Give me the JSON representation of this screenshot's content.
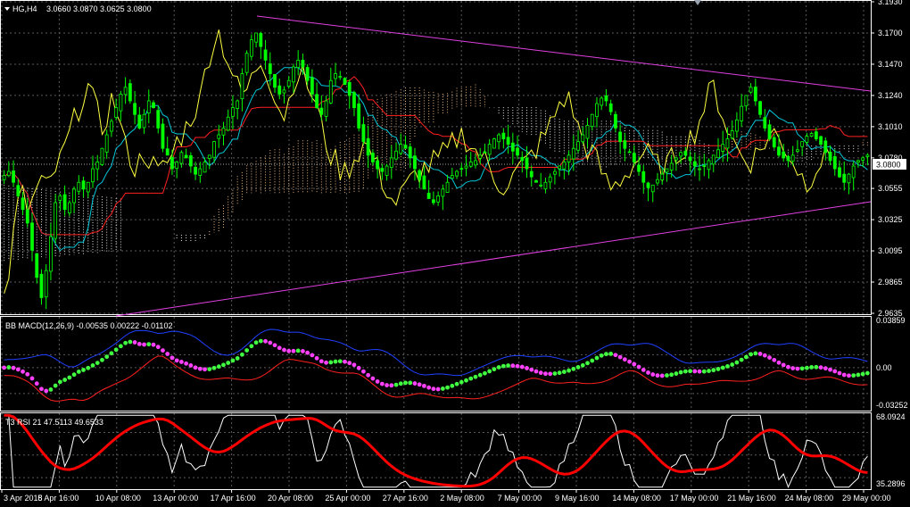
{
  "chart_title": "HG,H4",
  "ohlc": "3.0660 3.0870 3.0625 3.0800",
  "price_tag": "3.0800",
  "macd_title": "BB MACD(12,26,9) -0.00535 0.00222 -0.01102",
  "rsi_title": "T3 RSI 21 47.5113 49.6533",
  "colors": {
    "background": "#000000",
    "grid": "#5a5a5a",
    "bull": "#00ff00",
    "bear": "#00ff00",
    "tenkan": "#00c8d8",
    "kijun": "#ff2020",
    "chikou": "#ffff40",
    "kumo": "#ffc88c",
    "kumo2": "#ffffff",
    "trendline": "#e040e0",
    "macd_up": "#40ff40",
    "macd_down": "#ff40ff",
    "macd_upper": "#2040ff",
    "macd_lower": "#ff2020",
    "rsi_t3": "#ff0000",
    "rsi": "#ffffff"
  },
  "chart_data": [
    {
      "type": "candlestick",
      "title": "HG,H4",
      "ylim": [
        2.9635,
        3.193
      ],
      "y_ticks": [
        "3.1930",
        "3.1700",
        "3.1470",
        "3.1240",
        "3.1010",
        "3.0780",
        "3.0555",
        "3.0325",
        "3.0095",
        "2.9865",
        "2.9635"
      ],
      "last_price": 3.08,
      "x_labels": [
        "3 Apr 2018",
        "5 Apr 16:00",
        "10 Apr 08:00",
        "13 Apr 00:00",
        "17 Apr 16:00",
        "20 Apr 08:00",
        "25 Apr 00:00",
        "27 Apr 16:00",
        "2 May 08:00",
        "7 May 00:00",
        "9 May 16:00",
        "14 May 08:00",
        "17 May 00:00",
        "21 May 16:00",
        "24 May 08:00",
        "29 May 00:00"
      ],
      "bars": 190,
      "closes": [
        3.065,
        3.068,
        3.06,
        3.05,
        3.04,
        3.03,
        3.01,
        2.99,
        2.975,
        2.995,
        3.02,
        3.045,
        3.05,
        3.04,
        3.045,
        3.055,
        3.06,
        3.055,
        3.06,
        3.07,
        3.075,
        3.085,
        3.095,
        3.105,
        3.115,
        3.125,
        3.13,
        3.12,
        3.11,
        3.1,
        3.11,
        3.12,
        3.115,
        3.1,
        3.085,
        3.08,
        3.07,
        3.075,
        3.082,
        3.078,
        3.072,
        3.066,
        3.07,
        3.075,
        3.08,
        3.09,
        3.095,
        3.1,
        3.108,
        3.115,
        3.12,
        3.14,
        3.155,
        3.165,
        3.17,
        3.16,
        3.15,
        3.14,
        3.13,
        3.125,
        3.128,
        3.135,
        3.145,
        3.15,
        3.145,
        3.135,
        3.125,
        3.115,
        3.11,
        3.12,
        3.135,
        3.14,
        3.138,
        3.132,
        3.124,
        3.115,
        3.1,
        3.09,
        3.08,
        3.075,
        3.07,
        3.068,
        3.072,
        3.078,
        3.083,
        3.088,
        3.085,
        3.078,
        3.07,
        3.062,
        3.055,
        3.048,
        3.045,
        3.05,
        3.055,
        3.06,
        3.065,
        3.068,
        3.07,
        3.072,
        3.075,
        3.076,
        3.08,
        3.082,
        3.088,
        3.092,
        3.095,
        3.092,
        3.088,
        3.083,
        3.08,
        3.076,
        3.07,
        3.064,
        3.06,
        3.058,
        3.06,
        3.064,
        3.068,
        3.072,
        3.075,
        3.08,
        3.085,
        3.09,
        3.095,
        3.102,
        3.11,
        3.118,
        3.122,
        3.12,
        3.112,
        3.1,
        3.09,
        3.085,
        3.082,
        3.075,
        3.068,
        3.06,
        3.056,
        3.058,
        3.062,
        3.066,
        3.07,
        3.074,
        3.078,
        3.082,
        3.08,
        3.076,
        3.072,
        3.07,
        3.072,
        3.076,
        3.08,
        3.084,
        3.088,
        3.092,
        3.098,
        3.106,
        3.116,
        3.124,
        3.13,
        3.12,
        3.11,
        3.1,
        3.092,
        3.086,
        3.08,
        3.078,
        3.076,
        3.08,
        3.084,
        3.09,
        3.094,
        3.096,
        3.092,
        3.088,
        3.082,
        3.076,
        3.07,
        3.064,
        3.06,
        3.066,
        3.072,
        3.076,
        3.078,
        3.08
      ]
    },
    {
      "type": "line",
      "title": "BB MACD(12,26,9) -0.00535 0.00222 -0.01102",
      "ylim": [
        -0.03252,
        0.03859
      ],
      "y_ticks": [
        "0.03859",
        "0.00",
        "-0.03252"
      ]
    },
    {
      "type": "line",
      "title": "T3 RSI 21 47.5113 49.6533",
      "ylim": [
        35.2896,
        68.0924
      ],
      "y_ticks": [
        "68.0924",
        "35.2896"
      ]
    }
  ]
}
